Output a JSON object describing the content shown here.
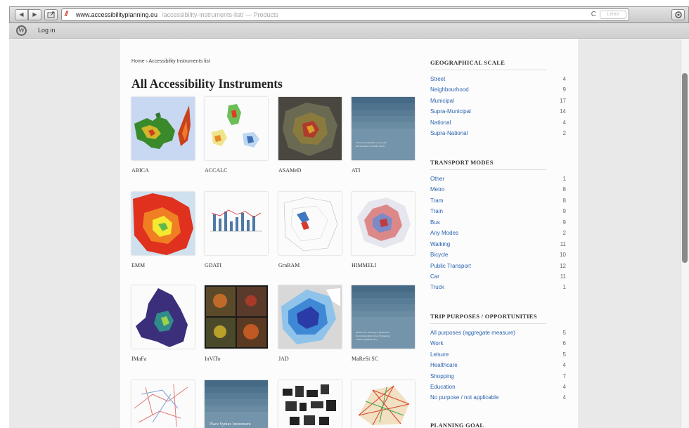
{
  "browser": {
    "url_domain": "www.accessibilityplanning.eu",
    "url_path": "/accessibility-instruments-list/ — Products",
    "reader_label": "Leitor",
    "back_glyph": "◀",
    "forward_glyph": "▶",
    "reload_glyph": "C",
    "icons": [
      "back-icon",
      "forward-icon",
      "share-icon",
      "site-icon",
      "reload-icon",
      "download-icon"
    ]
  },
  "adminbar": {
    "login_label": "Log in",
    "logo_glyph": "W"
  },
  "breadcrumb": "Home › Accessibility Instruments list",
  "page_title": "All Accessibility Instruments",
  "instruments": [
    {
      "label": "ABICA"
    },
    {
      "label": "ACCALC"
    },
    {
      "label": "ASAMeD"
    },
    {
      "label": "ATI"
    },
    {
      "label": "EMM"
    },
    {
      "label": "GDATI"
    },
    {
      "label": "GraBAM"
    },
    {
      "label": "HIMMELI"
    },
    {
      "label": "IMaFa"
    },
    {
      "label": "InViTo"
    },
    {
      "label": "JAD"
    },
    {
      "label": "MaReSi SC"
    },
    {
      "label": ""
    },
    {
      "label": ""
    },
    {
      "label": ""
    },
    {
      "label": ""
    }
  ],
  "tile_captions": {
    "ati": "From Accessibility to the Land Development Potential (ATI)",
    "maresi": "Method for Arriving at Maximum Recommendable Size of Shopping Centers (MaReSi SC)",
    "place_syntax": "Place Syntax Instrument"
  },
  "sidebar": {
    "geo": {
      "heading": "GEOGRAPHICAL SCALE",
      "items": [
        {
          "label": "Street",
          "count": "4"
        },
        {
          "label": "Neighbourhood",
          "count": "9"
        },
        {
          "label": "Municipal",
          "count": "17"
        },
        {
          "label": "Supra-Municipal",
          "count": "14"
        },
        {
          "label": "National",
          "count": "4"
        },
        {
          "label": "Supra-National",
          "count": "2"
        }
      ]
    },
    "transport": {
      "heading": "TRANSPORT MODES",
      "items": [
        {
          "label": "Other",
          "count": "1"
        },
        {
          "label": "Metro",
          "count": "8"
        },
        {
          "label": "Tram",
          "count": "8"
        },
        {
          "label": "Train",
          "count": "9"
        },
        {
          "label": "Bus",
          "count": "9"
        },
        {
          "label": "Any Modes",
          "count": "2"
        },
        {
          "label": "Walking",
          "count": "11"
        },
        {
          "label": "Bicycle",
          "count": "10"
        },
        {
          "label": "Public Transport",
          "count": "12"
        },
        {
          "label": "Car",
          "count": "11"
        },
        {
          "label": "Truck",
          "count": "1"
        }
      ]
    },
    "trip": {
      "heading": "TRIP PURPOSES / OPPORTUNITIES",
      "items": [
        {
          "label": "All purposes (aggregate measure)",
          "count": "5"
        },
        {
          "label": "Work",
          "count": "6"
        },
        {
          "label": "Leisure",
          "count": "5"
        },
        {
          "label": "Healthcare",
          "count": "4"
        },
        {
          "label": "Shopping",
          "count": "7"
        },
        {
          "label": "Education",
          "count": "4"
        },
        {
          "label": "No purpose / not applicable",
          "count": "4"
        }
      ]
    },
    "planning": {
      "heading": "PLANNING GOAL"
    }
  }
}
